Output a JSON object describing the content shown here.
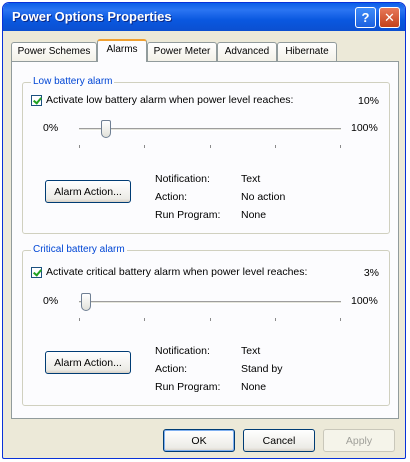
{
  "window": {
    "title": "Power Options Properties"
  },
  "title_buttons": {
    "help": "?",
    "close": "✕"
  },
  "tabs": [
    {
      "label": "Power Schemes"
    },
    {
      "label": "Alarms"
    },
    {
      "label": "Power Meter"
    },
    {
      "label": "Advanced"
    },
    {
      "label": "Hibernate"
    }
  ],
  "low_alarm": {
    "group_title": "Low battery alarm",
    "checkbox_label": "Activate low battery alarm when power level reaches:",
    "checked": true,
    "value": "10%",
    "slider_min": "0%",
    "slider_max": "100%",
    "slider_level_percent": 10,
    "button_label": "Alarm Action...",
    "notification_label": "Notification:",
    "notification_value": "Text",
    "action_label": "Action:",
    "action_value": "No action",
    "program_label": "Run Program:",
    "program_value": "None"
  },
  "critical_alarm": {
    "group_title": "Critical battery alarm",
    "checkbox_label": "Activate critical battery alarm when power level reaches:",
    "checked": true,
    "value": "3%",
    "slider_min": "0%",
    "slider_max": "100%",
    "slider_level_percent": 3,
    "button_label": "Alarm Action...",
    "notification_label": "Notification:",
    "notification_value": "Text",
    "action_label": "Action:",
    "action_value": "Stand by",
    "program_label": "Run Program:",
    "program_value": "None"
  },
  "footer": {
    "ok": "OK",
    "cancel": "Cancel",
    "apply": "Apply"
  }
}
